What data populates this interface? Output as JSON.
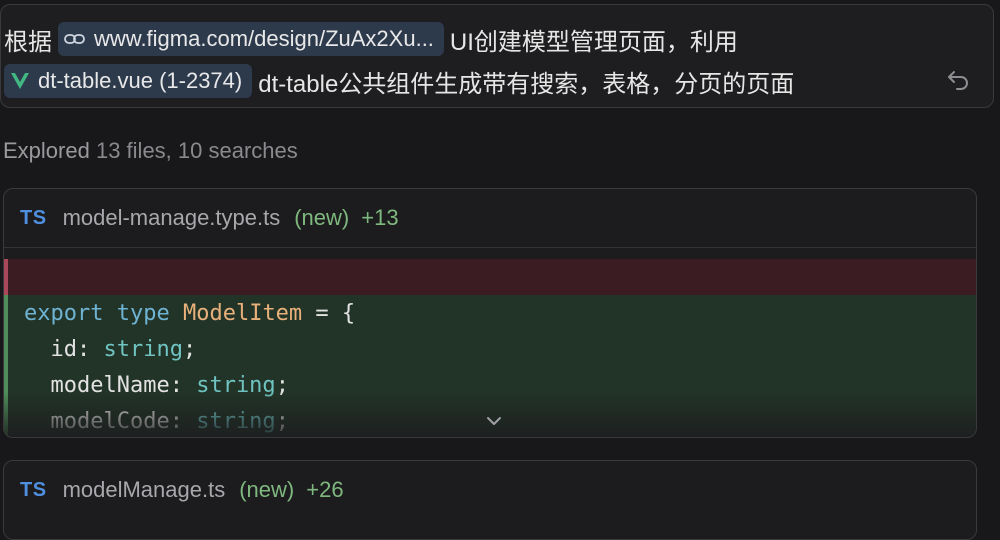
{
  "prompt": {
    "line1_prefix": "根据",
    "figma_chip": "www.figma.com/design/ZuAx2Xu...",
    "line1_suffix": "UI创建模型管理页面，利用",
    "file_chip": "dt-table.vue (1-2374)",
    "line2_suffix": "dt-table公共组件生成带有搜索，表格，分页的页面"
  },
  "explored": {
    "label": "Explored",
    "detail": "13 files, 10 searches"
  },
  "cards": [
    {
      "badge": "TS",
      "filename": "model-manage.type.ts",
      "status": "(new)",
      "added": "+13",
      "code": {
        "l1_kw1": "export",
        "l1_kw2": "type",
        "l1_type": "ModelItem",
        "l1_rest": " = {",
        "l2_key": "  id",
        "l2_colon": ": ",
        "l2_type": "string",
        "l2_end": ";",
        "l3_key": "  modelName",
        "l3_colon": ": ",
        "l3_type": "string",
        "l3_end": ";",
        "l4_key": "  modelCode",
        "l4_colon": ": ",
        "l4_type": "string",
        "l4_end": ";"
      }
    },
    {
      "badge": "TS",
      "filename": "modelManage.ts",
      "status": "(new)",
      "added": "+26"
    }
  ],
  "icons": {
    "link": "link-icon",
    "vue": "vue-logo-icon",
    "undo": "undo-icon",
    "expand": "chevron-down-icon"
  },
  "colors": {
    "chip_bg": "#2d3a4c",
    "ts_blue": "#4f8fe0",
    "added_green": "#7fb87f",
    "diff_added_bg": "#223428",
    "diff_removed_bg": "#3b1c22"
  }
}
